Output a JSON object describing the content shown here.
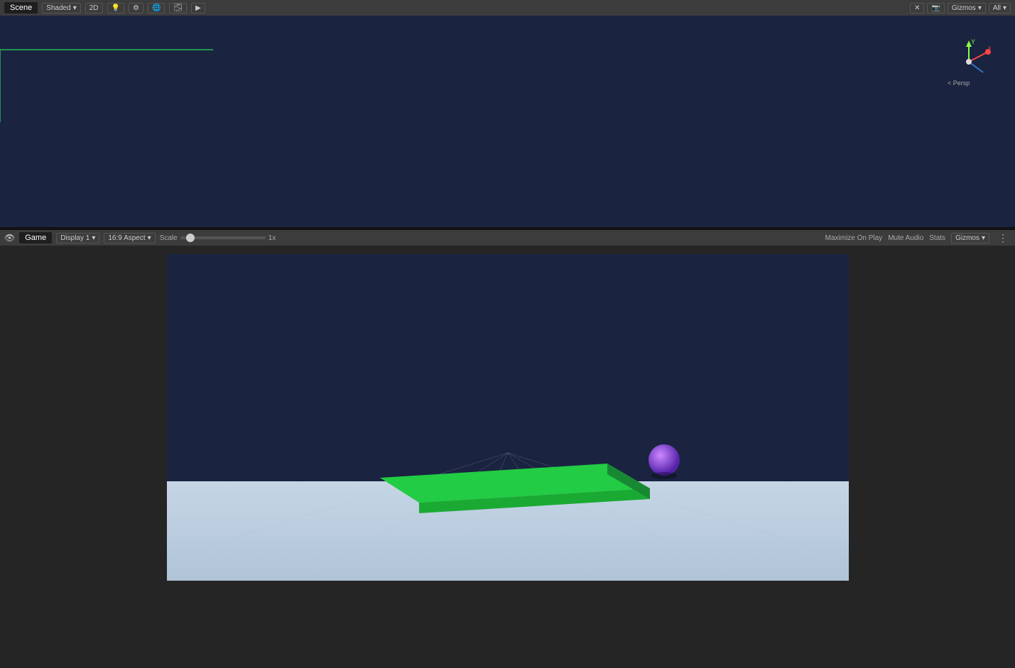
{
  "scene": {
    "tab_label": "Scene",
    "shading_label": "Shaded",
    "mode_2d": "2D",
    "toolbar_items": [
      "Shaded",
      "2D"
    ],
    "right_tools": {
      "cross_icon": "✕",
      "camera_icon": "📷",
      "gizmos_label": "Gizmos",
      "all_label": "All"
    },
    "gizmo": {
      "persp_label": "< Persp",
      "y_label": "Y",
      "x_label": "x"
    }
  },
  "game": {
    "tab_label": "Game",
    "tab_icon": "👁",
    "display_label": "Display 1",
    "aspect_label": "16:9 Aspect",
    "scale_label": "Scale",
    "scale_value": "1x",
    "maximize_label": "Maximize On Play",
    "mute_label": "Mute Audio",
    "stats_label": "Stats",
    "gizmos_label": "Gizmos",
    "dots_icon": "⋮"
  },
  "colors": {
    "accent": "#00ff88",
    "sphere_color": "#8844cc",
    "green_platform": "#22cc44",
    "floor": "#c8d8e8",
    "bg_dark": "#1a2340",
    "toolbar_bg": "#3c3c3c"
  }
}
